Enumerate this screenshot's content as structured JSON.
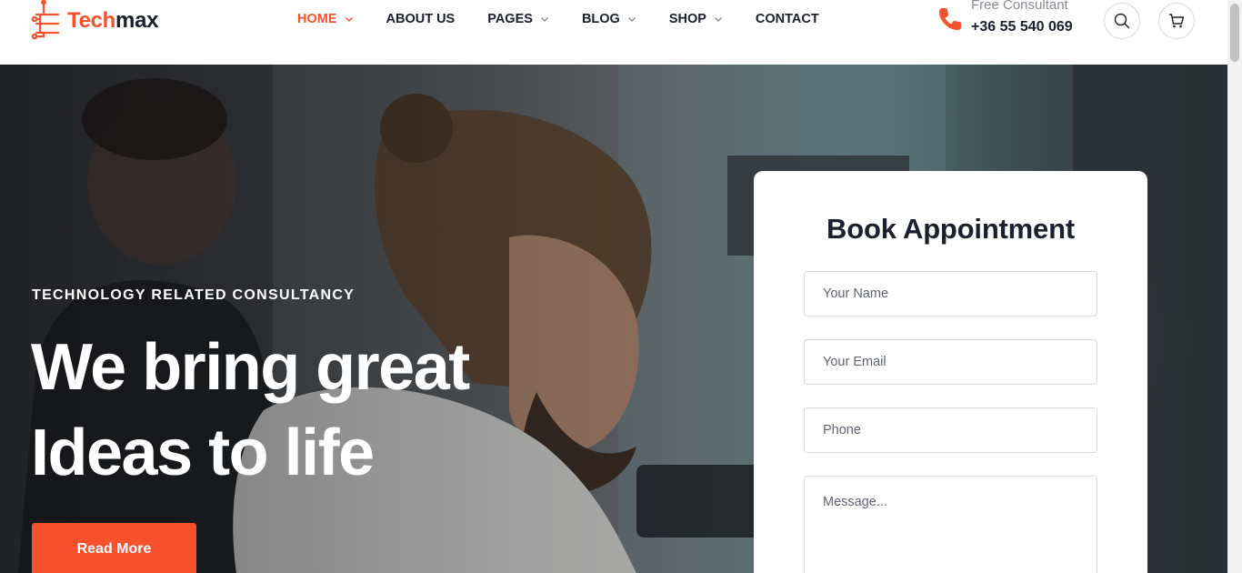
{
  "brand": {
    "name_part1": "Tech",
    "name_part2": "max",
    "accent": "#f4512c",
    "dark": "#1b1f2e"
  },
  "nav": {
    "items": [
      {
        "label": "HOME",
        "has_dropdown": true,
        "active": true
      },
      {
        "label": "ABOUT US",
        "has_dropdown": false,
        "active": false
      },
      {
        "label": "PAGES",
        "has_dropdown": true,
        "active": false
      },
      {
        "label": "BLOG",
        "has_dropdown": true,
        "active": false
      },
      {
        "label": "SHOP",
        "has_dropdown": true,
        "active": false
      },
      {
        "label": "CONTACT",
        "has_dropdown": false,
        "active": false
      }
    ]
  },
  "header": {
    "consult_label": "Free Consultant",
    "consult_number": "+36 55 540 069",
    "icons": {
      "phone": "phone-icon",
      "search": "search-icon",
      "cart": "cart-icon"
    }
  },
  "hero": {
    "kicker": "TECHNOLOGY RELATED CONSULTANCY",
    "title": "We bring great Ideas to life",
    "button_label": "Read More"
  },
  "appointment": {
    "title": "Book Appointment",
    "name_placeholder": "Your Name",
    "email_placeholder": "Your Email",
    "phone_placeholder": "Phone",
    "message_placeholder": "Message..."
  }
}
